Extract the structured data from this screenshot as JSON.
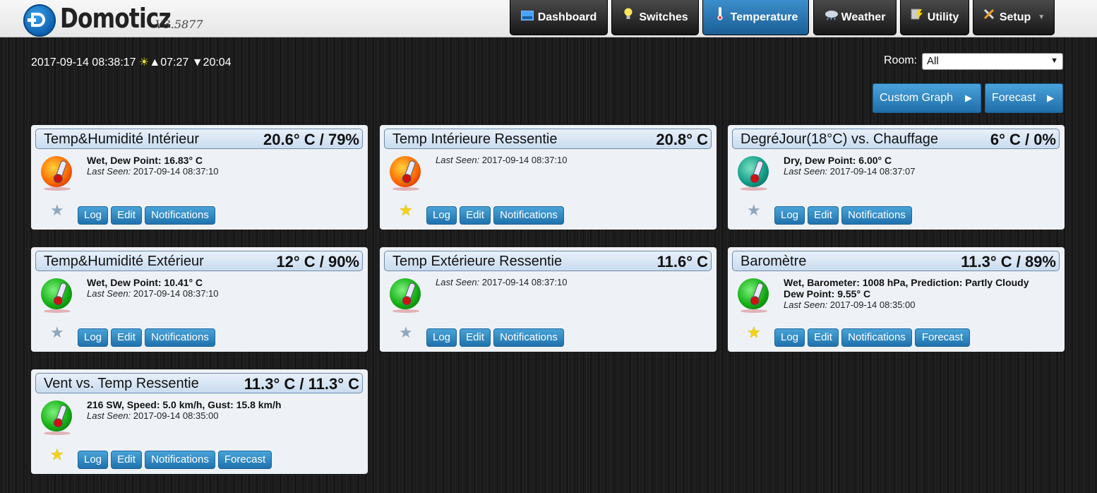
{
  "app": {
    "name": "Domoticz",
    "version": "V3.5877"
  },
  "nav": [
    {
      "label": "Dashboard",
      "icon": "dashboard-icon",
      "active": false
    },
    {
      "label": "Switches",
      "icon": "bulb-icon",
      "active": false
    },
    {
      "label": "Temperature",
      "icon": "thermometer-icon",
      "active": true
    },
    {
      "label": "Weather",
      "icon": "cloud-icon",
      "active": false
    },
    {
      "label": "Utility",
      "icon": "utility-icon",
      "active": false
    },
    {
      "label": "Setup",
      "icon": "tools-icon",
      "active": false
    }
  ],
  "status": {
    "datetime": "2017-09-14 08:38:17",
    "sunrise": "▲07:27",
    "sunset": "▼20:04"
  },
  "room": {
    "label": "Room:",
    "selected": "All"
  },
  "actions": {
    "custom_graph": "Custom Graph",
    "forecast": "Forecast"
  },
  "labels": {
    "last_seen": "Last Seen:"
  },
  "colors": {
    "accent": "#1f72ad",
    "active_tab": "#2a7ab8",
    "favorite": "#f5d312"
  },
  "devices": [
    {
      "name": "Temp&Humidité Intérieur",
      "value": "20.6° C / 79%",
      "line1": "Wet, Dew Point: 16.83° C",
      "line2": "",
      "last_seen": "2017-09-14 08:37:10",
      "favorite": false,
      "buttons": [
        "Log",
        "Edit",
        "Notifications"
      ]
    },
    {
      "name": "Temp Intérieure Ressentie",
      "value": "20.8° C",
      "line1": "",
      "line2": "",
      "last_seen": "2017-09-14 08:37:10",
      "favorite": true,
      "buttons": [
        "Log",
        "Edit",
        "Notifications"
      ]
    },
    {
      "name": "DegréJour(18°C) vs. Chauffage",
      "value": "6° C / 0%",
      "line1": "Dry, Dew Point: 6.00° C",
      "line2": "",
      "last_seen": "2017-09-14 08:37:07",
      "favorite": false,
      "buttons": [
        "Log",
        "Edit",
        "Notifications"
      ]
    },
    {
      "name": "Temp&Humidité Extérieur",
      "value": "12° C / 90%",
      "line1": "Wet, Dew Point: 10.41° C",
      "line2": "",
      "last_seen": "2017-09-14 08:37:10",
      "favorite": false,
      "buttons": [
        "Log",
        "Edit",
        "Notifications"
      ]
    },
    {
      "name": "Temp Extérieure Ressentie",
      "value": "11.6° C",
      "line1": "",
      "line2": "",
      "last_seen": "2017-09-14 08:37:10",
      "favorite": false,
      "buttons": [
        "Log",
        "Edit",
        "Notifications"
      ]
    },
    {
      "name": "Baromètre",
      "value": "11.3° C / 89%",
      "line1": "Wet, Barometer: 1008 hPa, Prediction: Partly Cloudy",
      "line2": "Dew Point: 9.55° C",
      "last_seen": "2017-09-14 08:35:00",
      "favorite": true,
      "buttons": [
        "Log",
        "Edit",
        "Notifications",
        "Forecast"
      ]
    },
    {
      "name": "Vent vs. Temp Ressentie",
      "value": "11.3° C / 11.3° C",
      "line1": "216 SW, Speed: 5.0 km/h, Gust: 15.8 km/h",
      "line2": "",
      "last_seen": "2017-09-14 08:35:00",
      "favorite": true,
      "buttons": [
        "Log",
        "Edit",
        "Notifications",
        "Forecast"
      ]
    }
  ]
}
